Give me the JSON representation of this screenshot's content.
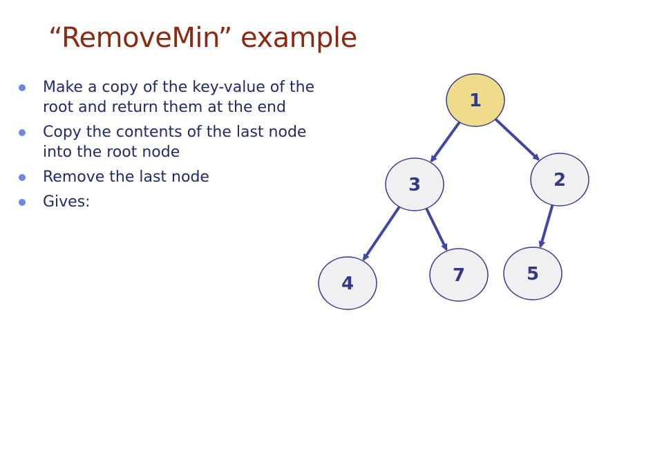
{
  "slide": {
    "title": "“RemoveMin” example"
  },
  "bullets": [
    {
      "text": "Make a copy of the key-value of the root and return them at the end"
    },
    {
      "text": "Copy the contents of the last node into the root node"
    },
    {
      "text": "Remove the last node"
    },
    {
      "text": "Gives:"
    }
  ],
  "tree": {
    "colors": {
      "root_fill": "#efdb8c",
      "node_fill": "#f0f0f2",
      "node_stroke": "#343a86",
      "edge": "#3f47a0",
      "label": "#343a80"
    },
    "nodes": [
      {
        "id": "n1",
        "label": "1",
        "highlight": true
      },
      {
        "id": "n3",
        "label": "3",
        "highlight": false
      },
      {
        "id": "n2",
        "label": "2",
        "highlight": false
      },
      {
        "id": "n4",
        "label": "4",
        "highlight": false
      },
      {
        "id": "n7",
        "label": "7",
        "highlight": false
      },
      {
        "id": "n5",
        "label": "5",
        "highlight": false
      }
    ],
    "edges": [
      {
        "from": "n1",
        "to": "n3"
      },
      {
        "from": "n1",
        "to": "n2"
      },
      {
        "from": "n3",
        "to": "n4"
      },
      {
        "from": "n3",
        "to": "n7"
      },
      {
        "from": "n2",
        "to": "n5"
      }
    ]
  }
}
